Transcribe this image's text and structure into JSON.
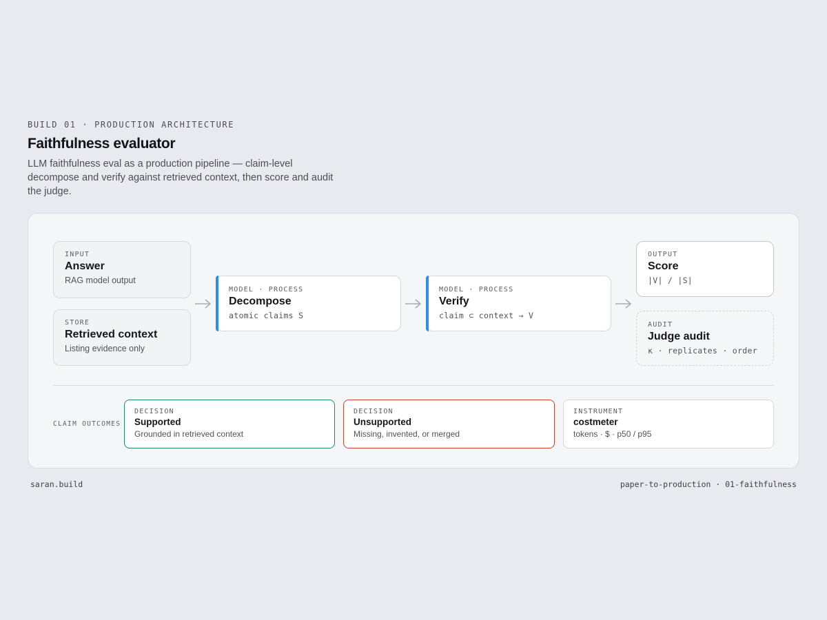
{
  "header": {
    "eyebrow": "BUILD 01 · PRODUCTION ARCHITECTURE",
    "title": "Faithfulness evaluator",
    "subtitle": "LLM faithfulness eval as a production pipeline — claim-level decompose and verify against retrieved context, then score and audit the judge."
  },
  "pipeline": {
    "input": {
      "tag": "INPUT",
      "name": "Answer",
      "desc": "RAG model output"
    },
    "store": {
      "tag": "STORE",
      "name": "Retrieved context",
      "desc": "Listing evidence only"
    },
    "decompose": {
      "tag": "MODEL · PROCESS",
      "name": "Decompose",
      "desc": "atomic claims S"
    },
    "verify": {
      "tag": "MODEL · PROCESS",
      "name": "Verify",
      "desc": "claim ⊂ context → V"
    },
    "output": {
      "tag": "OUTPUT",
      "name": "Score",
      "desc": "|V| / |S|"
    },
    "audit": {
      "tag": "AUDIT",
      "name": "Judge audit",
      "desc": "κ · replicates · order"
    }
  },
  "outcomes": {
    "label": "CLAIM OUTCOMES",
    "cards": [
      {
        "tag": "DECISION",
        "name": "Supported",
        "desc": "Grounded in retrieved context"
      },
      {
        "tag": "DECISION",
        "name": "Unsupported",
        "desc": "Missing, invented, or merged"
      },
      {
        "tag": "INSTRUMENT",
        "name": "costmeter",
        "desc": "tokens · $ · p50 / p95"
      }
    ]
  },
  "colors": {
    "process_accent": "#2d8fe0",
    "supported": "#1f8a6a",
    "unsupported": "#c9452c"
  },
  "footer": {
    "left": "saran.build",
    "right": "paper-to-production · 01-faithfulness"
  }
}
